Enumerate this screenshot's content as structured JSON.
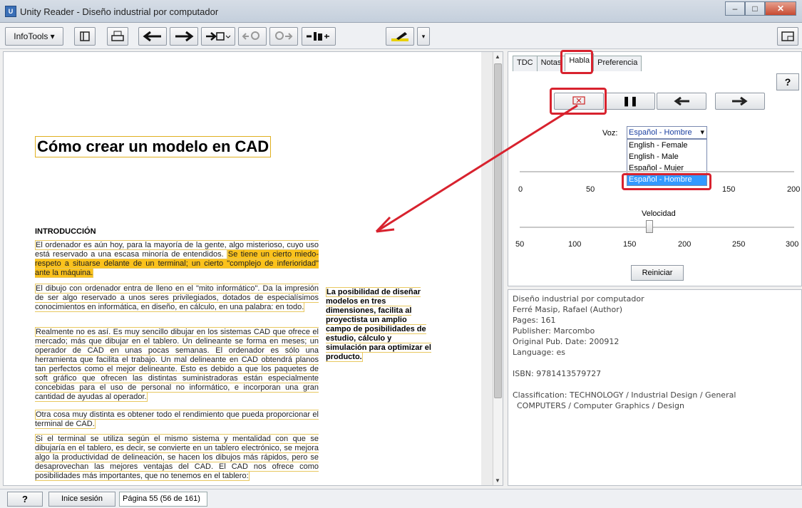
{
  "window": {
    "title": "Unity Reader - Diseño industrial por computador",
    "minimize": "–",
    "maximize": "□",
    "close": "✕"
  },
  "toolbar": {
    "infotools_label": "InfoTools",
    "icons": [
      "toc-icon",
      "print-icon",
      "back-arrow-icon",
      "forward-arrow-icon",
      "bookmark-add-icon",
      "zoom-out-icon",
      "zoom-in-icon",
      "page-fit-icon",
      "highlighter-icon",
      "dropdown-icon",
      "window-icon"
    ]
  },
  "document": {
    "title": "Cómo crear un modelo en CAD",
    "section_heading": "INTRODUCCIÓN",
    "paragraphs": [
      {
        "normal": "El ordenador es aún hoy, para la mayoría de la gente, algo misterioso, cuyo uso está reservado a una escasa minoría de entendidos. ",
        "highlighted": "Se tiene un cierto miedo-respeto a situarse delante de un terminal; un cierto \"complejo de inferioridad\" ante la máquina."
      },
      {
        "normal": "El dibujo con ordenador entra de lleno en el \"mito informático\". Da la impresión de ser algo reservado a unos seres privilegiados, dotados de especialísimos conocimientos en informática, en diseño, en cálculo, en una palabra: en todo.",
        "highlighted": ""
      },
      {
        "normal": "Realmente no es así. Es muy sencillo dibujar en los sistemas CAD que ofrece el mercado; más que dibujar en el tablero. Un delineante se forma en meses; un operador de CAD en unas pocas semanas. El ordenador es sólo una herramienta que facilita el trabajo. Un mal delineante en CAD obtendrá planos tan perfectos como el mejor delineante. Esto es debido a que los paquetes de soft gráfico que ofrecen las distintas suministradoras están especialmente concebidas para el uso de personal no informático, e incorporan una gran cantidad de ayudas al operador.",
        "highlighted": ""
      },
      {
        "normal": "Otra cosa muy distinta es obtener todo el rendimiento que pueda proporcionar el terminal de CAD.",
        "highlighted": ""
      },
      {
        "normal": "Si el terminal se utiliza según el mismo sistema y mentalidad con que se dibujaría en el tablero, es decir, se convierte en un tablero electrónico, se mejora algo la productividad de delineación, se hacen los dibujos más rápidos, pero se desaprovechan las mejores ventajas del CAD. El CAD nos ofrece como posibilidades más importantes, que no tenemos en el tablero:",
        "highlighted": ""
      }
    ],
    "side_note": "La posibilidad de diseñar modelos en tres dimensiones, facilita al proyectista un amplio campo de posibilidades de estudio, cálculo y simulación para optimizar el producto."
  },
  "tabs": [
    "TDC",
    "Notas",
    "Habla",
    "Preferencia"
  ],
  "active_tab": "Habla",
  "speech": {
    "help": "?",
    "voz_label": "Voz:",
    "voz_selected": "Español - Hombre",
    "voz_options": [
      "English - Female",
      "English - Male",
      "Español - Mujer",
      "Español - Hombre"
    ],
    "volume_ticks": [
      "0",
      "50",
      "100",
      "150",
      "200"
    ],
    "volume_value": 100,
    "velocidad_label": "Velocidad",
    "speed_ticks": [
      "50",
      "100",
      "150",
      "200",
      "250",
      "300"
    ],
    "speed_value": 150,
    "reset_label": "Reiniciar"
  },
  "book_info": {
    "title": "Diseño industrial por computador",
    "author": "Ferré Masip, Rafael (Author)",
    "pages": "Pages: 161",
    "publisher": "Publisher: Marcombo",
    "pub_date": "Original Pub. Date: 200912",
    "language": "Language: es",
    "isbn": "ISBN: 9781413579727",
    "classification": "Classification: TECHNOLOGY / Industrial Design / General",
    "classification2": "COMPUTERS / Computer Graphics / Design"
  },
  "status": {
    "help": "?",
    "login": "Inice sesión",
    "page": "Página 55 (56 de 161)"
  }
}
